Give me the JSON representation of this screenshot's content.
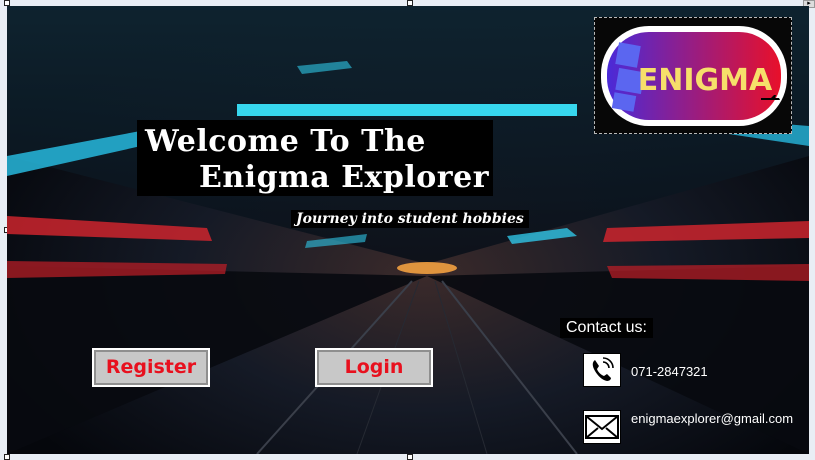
{
  "title": {
    "line1": "Welcome To The",
    "line2": "Enigma Explorer"
  },
  "subtitle": "Journey into student hobbies",
  "logo": {
    "text": "ENIGMA",
    "colors": {
      "gradient_start": "#4a2ad8",
      "gradient_end": "#e8102a",
      "letters": "#f6df6a",
      "blocks": "#5b66f0"
    }
  },
  "buttons": {
    "register": "Register",
    "login": "Login"
  },
  "contact": {
    "label": "Contact us:",
    "phone": "071-2847321",
    "email": "enigmaexplorer@gmail.com"
  },
  "icons": {
    "phone": "phone-icon",
    "mail": "mail-icon",
    "scroll": "scroll-right-arrow-icon"
  },
  "colors": {
    "button_text": "#e8101e",
    "button_bg": "#c8c8c8"
  }
}
